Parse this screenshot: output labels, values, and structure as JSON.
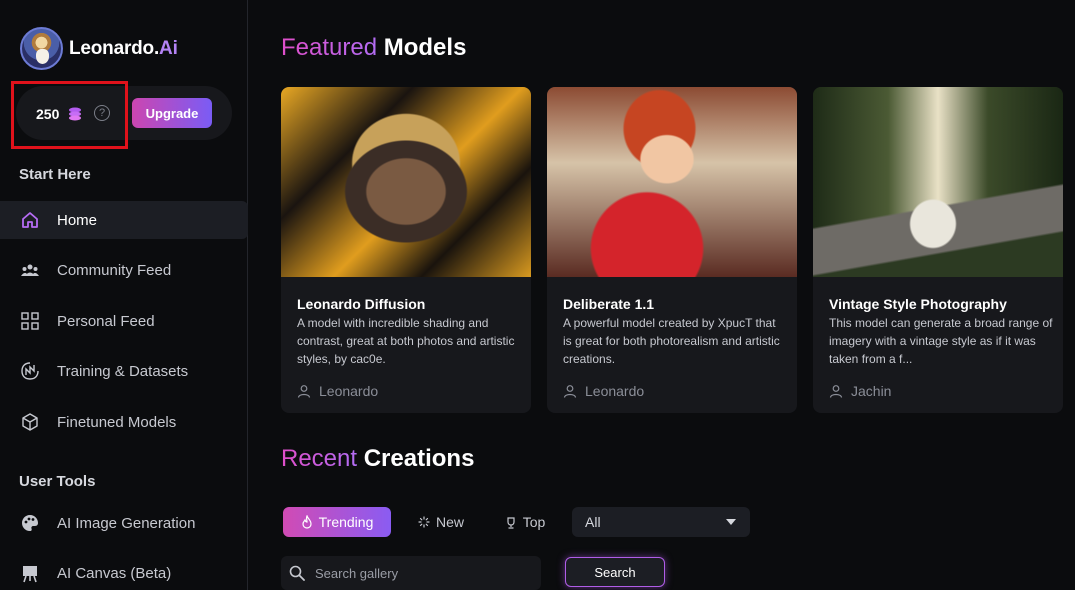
{
  "brand": {
    "name_main": "Leonardo.",
    "name_accent": "Ai"
  },
  "tokens": {
    "count": "250",
    "help": "?",
    "upgrade_label": "Upgrade"
  },
  "sidebar": {
    "start_here": "Start Here",
    "start_items": [
      {
        "label": "Home",
        "icon": "home-icon"
      },
      {
        "label": "Community Feed",
        "icon": "community-icon"
      },
      {
        "label": "Personal Feed",
        "icon": "grid-icon"
      },
      {
        "label": "Training & Datasets",
        "icon": "training-icon"
      },
      {
        "label": "Finetuned Models",
        "icon": "cube-icon"
      }
    ],
    "user_tools": "User Tools",
    "tool_items": [
      {
        "label": "AI Image Generation",
        "icon": "palette-icon"
      },
      {
        "label": "AI Canvas (Beta)",
        "icon": "easel-icon"
      }
    ]
  },
  "featured": {
    "title_accent": "Featured",
    "title_rest": "Models",
    "cards": [
      {
        "title": "Leonardo Diffusion",
        "description": "A model with incredible shading and contrast, great at both photos and artistic styles, by cac0e.",
        "author": "Leonardo"
      },
      {
        "title": "Deliberate 1.1",
        "description": "A powerful model created by XpucT that is great for both photorealism and artistic creations.",
        "author": "Leonardo"
      },
      {
        "title": "Vintage Style Photography",
        "description": "This model can generate a broad range of imagery with a vintage style as if it was taken from a f...",
        "author": "Jachin"
      }
    ]
  },
  "recent": {
    "title_accent": "Recent",
    "title_rest": "Creations",
    "tabs": [
      {
        "label": "Trending",
        "icon": "flame-icon"
      },
      {
        "label": "New",
        "icon": "sparkle-icon"
      },
      {
        "label": "Top",
        "icon": "trophy-icon"
      }
    ],
    "filter_value": "All",
    "search_placeholder": "Search gallery",
    "search_button": "Search"
  },
  "colors": {
    "accent_pink": "#d14bb4",
    "accent_purple": "#8a5cf2",
    "highlight_red": "#e0121b"
  }
}
